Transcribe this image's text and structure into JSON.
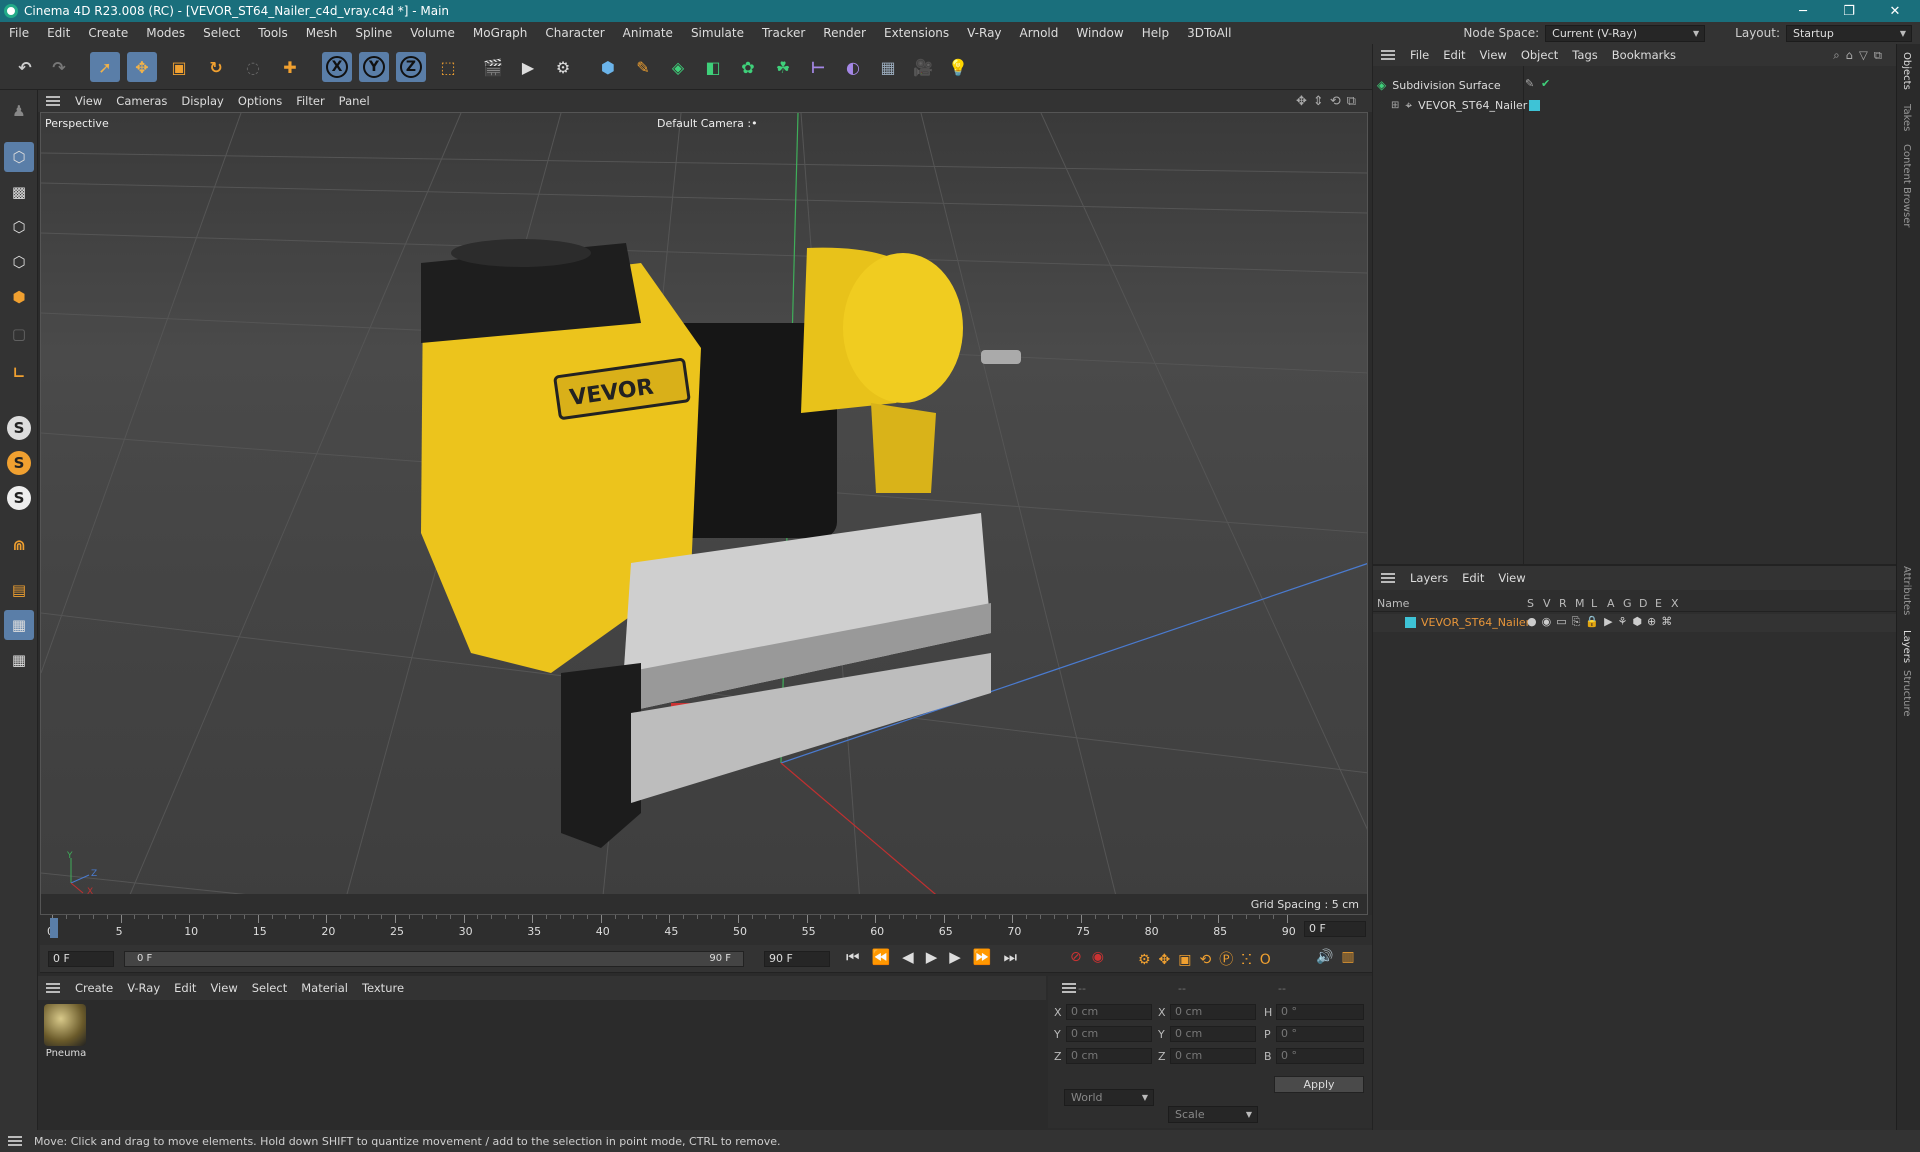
{
  "window": {
    "title": "Cinema 4D R23.008 (RC) - [VEVOR_ST64_Nailer_c4d_vray.c4d *] - Main",
    "minimize": "─",
    "restore": "❐",
    "close": "✕"
  },
  "menu": [
    "File",
    "Edit",
    "Create",
    "Modes",
    "Select",
    "Tools",
    "Mesh",
    "Spline",
    "Volume",
    "MoGraph",
    "Character",
    "Animate",
    "Simulate",
    "Tracker",
    "Render",
    "Extensions",
    "V-Ray",
    "Arnold",
    "Window",
    "Help",
    "3DToAll"
  ],
  "node_space": {
    "label": "Node Space:",
    "value": "Current (V-Ray)"
  },
  "layout": {
    "label": "Layout:",
    "value": "Startup"
  },
  "viewport": {
    "menu": [
      "View",
      "Cameras",
      "Display",
      "Options",
      "Filter",
      "Panel"
    ],
    "name": "Perspective",
    "camera": "Default Camera",
    "camera_suffix": ":•",
    "grid_spacing": "Grid Spacing : 5 cm",
    "brand_text": "VEVOR",
    "axis_y": "Y",
    "axis_z": "Z",
    "axis_x": "X"
  },
  "toolbar": {
    "x": "X",
    "y": "Y",
    "z": "Z"
  },
  "lefttools": {
    "s1": "S",
    "s2": "S",
    "s3": "S"
  },
  "timeline": {
    "ticks": [
      "0",
      "5",
      "10",
      "15",
      "20",
      "25",
      "30",
      "35",
      "40",
      "45",
      "50",
      "55",
      "60",
      "65",
      "70",
      "75",
      "80",
      "85",
      "90"
    ],
    "current_frame": "0 F",
    "start": "0 F",
    "range_start": "0 F",
    "range_end": "90 F",
    "end": "90 F"
  },
  "material": {
    "menu": [
      "Create",
      "V-Ray",
      "Edit",
      "View",
      "Select",
      "Material",
      "Texture"
    ],
    "items": [
      {
        "name": "Pneuma"
      }
    ]
  },
  "coords": {
    "headers": [
      "--",
      "--",
      "--"
    ],
    "rows": [
      {
        "a": "X",
        "av": "0 cm",
        "b": "X",
        "bv": "0 cm",
        "c": "H",
        "cv": "0 °"
      },
      {
        "a": "Y",
        "av": "0 cm",
        "b": "Y",
        "bv": "0 cm",
        "c": "P",
        "cv": "0 °"
      },
      {
        "a": "Z",
        "av": "0 cm",
        "b": "Z",
        "bv": "0 cm",
        "c": "B",
        "cv": "0 °"
      }
    ],
    "space": "World",
    "mode": "Scale",
    "apply": "Apply"
  },
  "objects": {
    "menu": [
      "File",
      "Edit",
      "View",
      "Object",
      "Tags",
      "Bookmarks"
    ],
    "items": [
      {
        "name": "Subdivision Surface"
      },
      {
        "name": "VEVOR_ST64_Nailer"
      }
    ]
  },
  "layers": {
    "menu": [
      "Layers",
      "Edit",
      "View"
    ],
    "columns": {
      "name": "Name",
      "flags": [
        "S",
        "V",
        "R",
        "M",
        "L",
        "A",
        "G",
        "D",
        "E",
        "X"
      ]
    },
    "items": [
      {
        "name": "VEVOR_ST64_Nailer",
        "color": "#3ec3d6"
      }
    ]
  },
  "side_tabs": [
    "Objects",
    "Takes",
    "Content Browser",
    "Attributes",
    "Layers",
    "Structure"
  ],
  "status": "Move: Click and drag to move elements. Hold down SHIFT to quantize movement / add to the selection in point mode, CTRL to remove.",
  "colors": {
    "accent": "#5a7ea8",
    "titlebar": "#1a6f7c",
    "layer": "#3ec3d6",
    "highlight": "#e8963a"
  }
}
